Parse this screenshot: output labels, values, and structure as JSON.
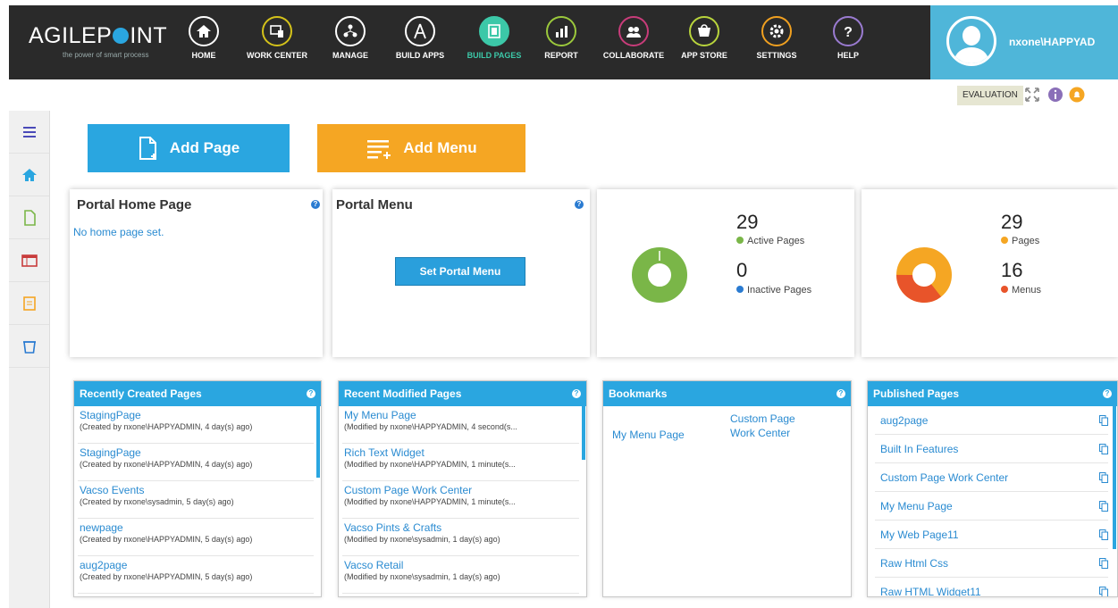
{
  "app": {
    "logo_text_1": "AGILEP",
    "logo_text_2": "INT",
    "tagline": "the power of smart process"
  },
  "nav": [
    {
      "label": "HOME",
      "icon": "home-icon",
      "color": "#ffffff"
    },
    {
      "label": "WORK CENTER",
      "icon": "work-center-icon",
      "color": "#d4c21a"
    },
    {
      "label": "MANAGE",
      "icon": "manage-icon",
      "color": "#ffffff"
    },
    {
      "label": "BUILD APPS",
      "icon": "build-apps-icon",
      "color": "#ffffff"
    },
    {
      "label": "BUILD PAGES",
      "icon": "build-pages-icon",
      "color": "#3cc8a8"
    },
    {
      "label": "REPORT",
      "icon": "report-icon",
      "color": "#9bc83c"
    },
    {
      "label": "COLLABORATE",
      "icon": "collaborate-icon",
      "color": "#c83c7a"
    },
    {
      "label": "APP STORE",
      "icon": "app-store-icon",
      "color": "#b8d43c"
    },
    {
      "label": "SETTINGS",
      "icon": "settings-icon",
      "color": "#f0a020"
    },
    {
      "label": "HELP",
      "icon": "help-icon",
      "color": "#9a7bd1"
    }
  ],
  "user": {
    "name": "nxone\\HAPPYAD"
  },
  "eval": {
    "label": "EVALUATION"
  },
  "actions": {
    "add_page": "Add Page",
    "add_menu": "Add Menu"
  },
  "portal_home": {
    "title": "Portal Home Page",
    "empty": "No home page set."
  },
  "portal_menu": {
    "title": "Portal Menu",
    "button": "Set Portal Menu"
  },
  "pages_stats": {
    "active_count": "29",
    "active_label": "Active Pages",
    "inactive_count": "0",
    "inactive_label": "Inactive Pages"
  },
  "menu_stats": {
    "pages_count": "29",
    "pages_label": "Pages",
    "menus_count": "16",
    "menus_label": "Menus"
  },
  "colors": {
    "green": "#7ab648",
    "blue": "#2a7bd1",
    "orange": "#f5a623",
    "red": "#e8542a",
    "accent": "#2aa6e0"
  },
  "recent_created": {
    "title": "Recently Created Pages",
    "items": [
      {
        "name": "StagingPage",
        "meta": "(Created by nxone\\HAPPYADMIN, 4 day(s) ago)"
      },
      {
        "name": "StagingPage",
        "meta": "(Created by nxone\\HAPPYADMIN, 4 day(s) ago)"
      },
      {
        "name": "Vacso Events",
        "meta": "(Created by nxone\\sysadmin, 5 day(s) ago)"
      },
      {
        "name": "newpage",
        "meta": "(Created by nxone\\HAPPYADMIN, 5 day(s) ago)"
      },
      {
        "name": "aug2page",
        "meta": "(Created by nxone\\HAPPYADMIN, 5 day(s) ago)"
      }
    ]
  },
  "recent_modified": {
    "title": "Recent Modified Pages",
    "items": [
      {
        "name": "My Menu Page",
        "meta": "(Modified by nxone\\HAPPYADMIN, 4 second(s..."
      },
      {
        "name": "Rich Text Widget",
        "meta": "(Modified by nxone\\HAPPYADMIN, 1 minute(s..."
      },
      {
        "name": "Custom Page Work Center",
        "meta": "(Modified by nxone\\HAPPYADMIN, 1 minute(s..."
      },
      {
        "name": "Vacso Pints & Crafts",
        "meta": "(Modified by nxone\\sysadmin, 1 day(s) ago)"
      },
      {
        "name": "Vacso Retail",
        "meta": "(Modified by nxone\\sysadmin, 1 day(s) ago)"
      }
    ]
  },
  "bookmarks": {
    "title": "Bookmarks",
    "items": [
      "My Menu Page",
      "Custom Page Work Center"
    ]
  },
  "published": {
    "title": "Published Pages",
    "items": [
      "aug2page",
      "Built In Features",
      "Custom Page Work Center",
      "My Menu Page",
      "My Web Page11",
      "Raw Html Css",
      "Raw HTML Widget11"
    ]
  }
}
